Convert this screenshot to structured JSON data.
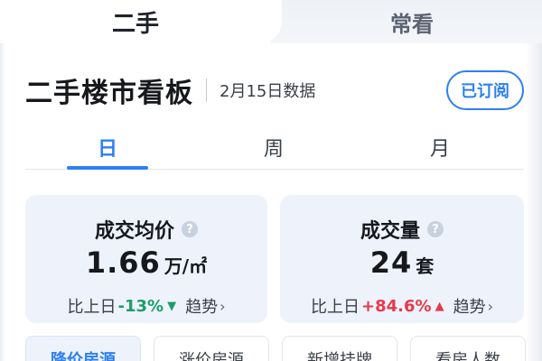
{
  "top_tabs": {
    "active": "二手",
    "inactive": "常看"
  },
  "header": {
    "title": "二手楼市看板",
    "date": "2月15日数据",
    "subscribe_label": "已订阅"
  },
  "period_tabs": [
    "日",
    "周",
    "月"
  ],
  "active_period": "日",
  "cards": [
    {
      "title": "成交均价",
      "value": "1.66",
      "unit": "万/㎡",
      "compare_label": "比上日",
      "change": "-13%",
      "direction": "down",
      "arrow": "▼",
      "trend_label": "趋势"
    },
    {
      "title": "成交量",
      "value": "24",
      "unit": "套",
      "compare_label": "比上日",
      "change": "+84.6%",
      "direction": "up",
      "arrow": "▲",
      "trend_label": "趋势"
    }
  ],
  "chips": [
    "降价房源",
    "涨价房源",
    "新增挂牌",
    "看房人数"
  ],
  "active_chip": "降价房源",
  "help_glyph": "?",
  "chevron_glyph": "›",
  "colors": {
    "accent": "#2e7ff3",
    "down": "#1a9e6a",
    "up": "#e8384a",
    "card_bg": "#eef3fb"
  },
  "icons": [
    "help-icon",
    "chevron-right-icon",
    "triangle-down-icon",
    "triangle-up-icon"
  ]
}
